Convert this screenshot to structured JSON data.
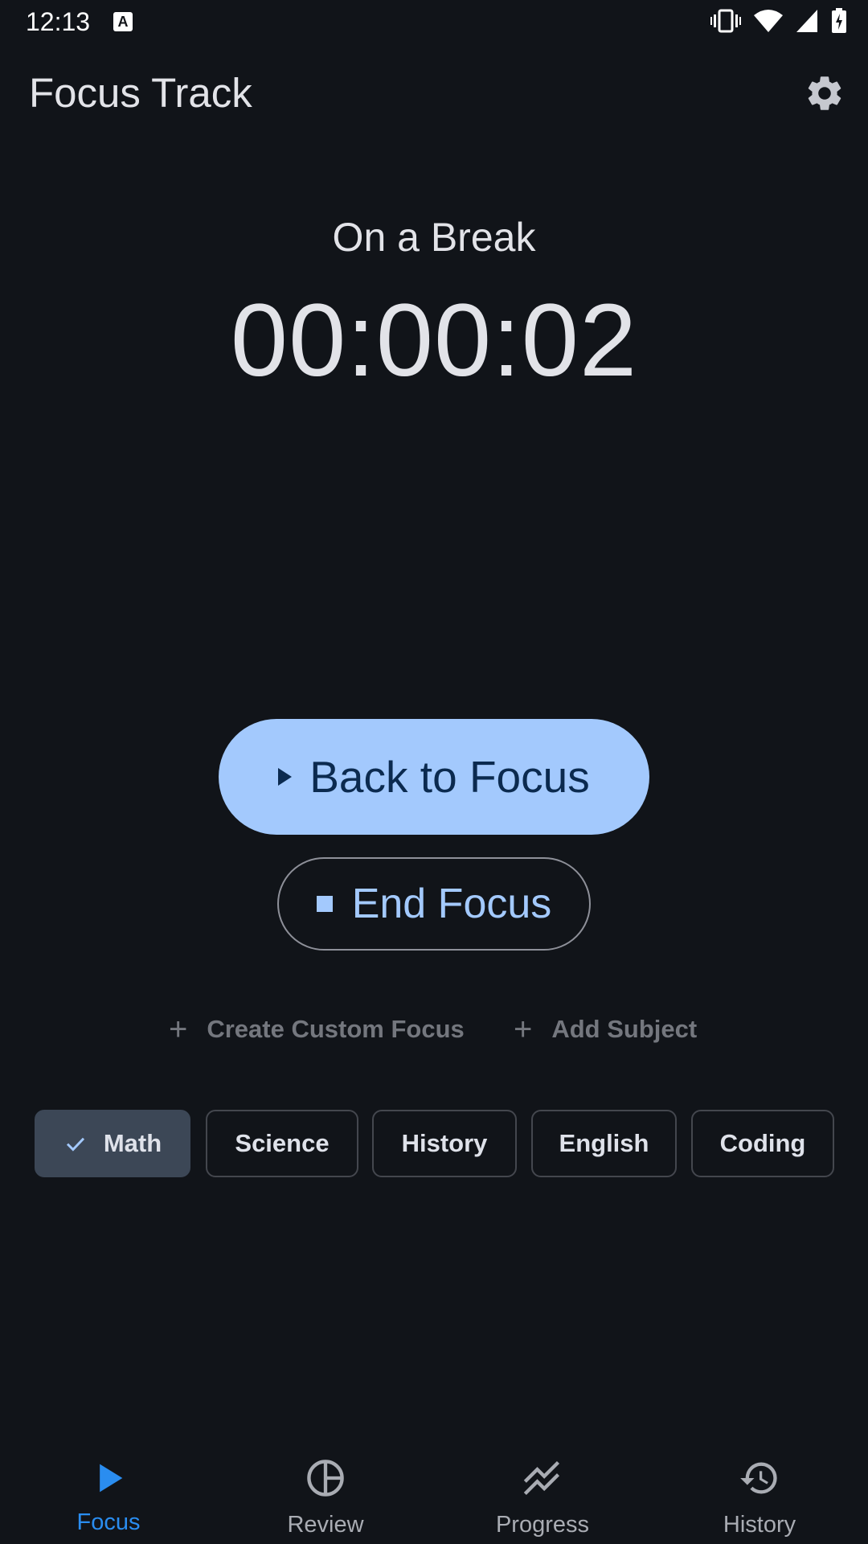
{
  "status_bar": {
    "time": "12:13",
    "notification_icon_letter": "A"
  },
  "app_bar": {
    "title": "Focus Track",
    "settings_icon": "gear-icon"
  },
  "timer": {
    "status": "On a Break",
    "elapsed": "00:00:02"
  },
  "actions": {
    "back_to_focus": "Back to Focus",
    "end_focus": "End Focus",
    "create_custom_focus": "Create Custom Focus",
    "add_subject": "Add Subject"
  },
  "subjects": [
    {
      "label": "Math",
      "selected": true
    },
    {
      "label": "Science",
      "selected": false
    },
    {
      "label": "History",
      "selected": false
    },
    {
      "label": "English",
      "selected": false
    },
    {
      "label": "Coding",
      "selected": false
    }
  ],
  "bottom_nav": [
    {
      "label": "Focus",
      "icon": "play-icon",
      "active": true
    },
    {
      "label": "Review",
      "icon": "pie-chart-icon",
      "active": false
    },
    {
      "label": "Progress",
      "icon": "trending-icon",
      "active": false
    },
    {
      "label": "History",
      "icon": "history-icon",
      "active": false
    }
  ],
  "colors": {
    "background": "#111419",
    "primary": "#a3c9fd",
    "nav_active": "#2a8df0",
    "chip_selected": "#3c4756"
  }
}
